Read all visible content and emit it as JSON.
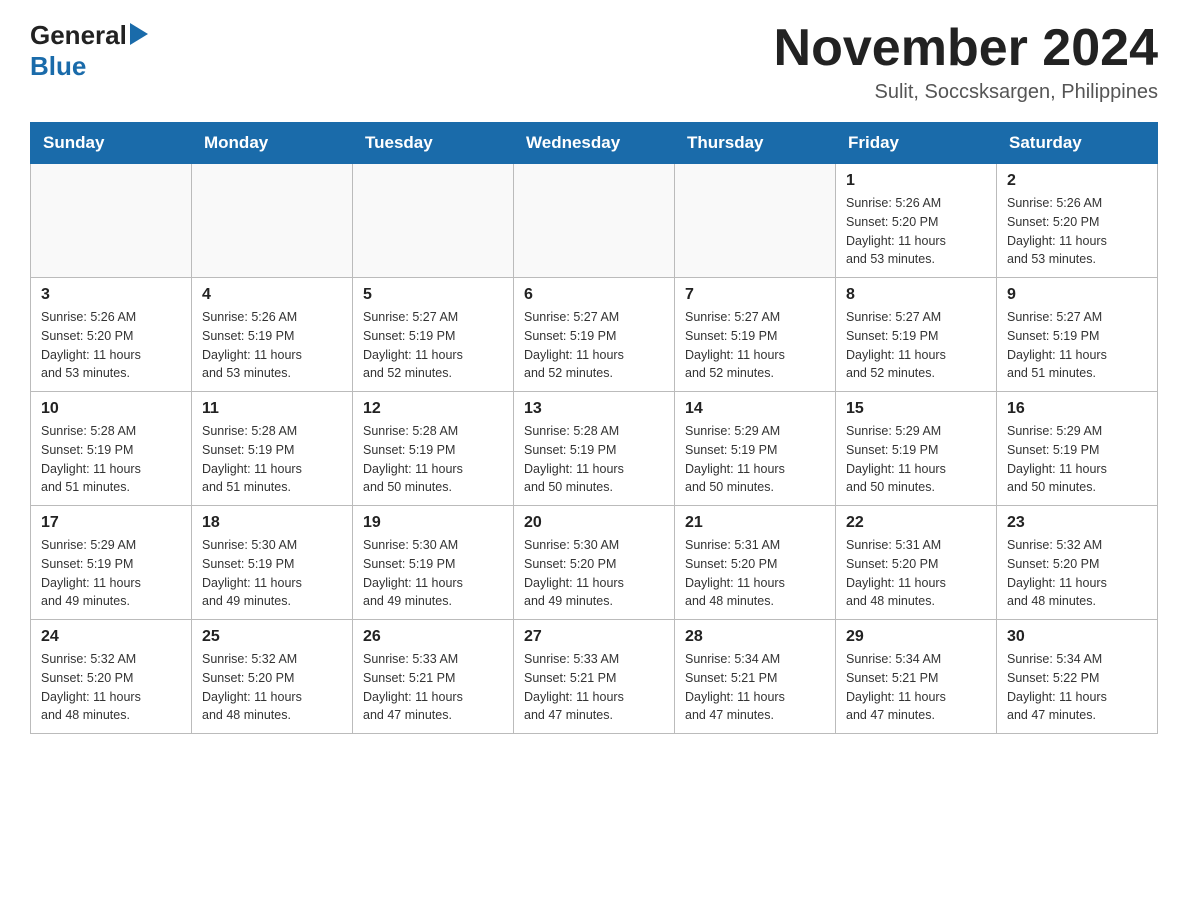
{
  "header": {
    "logo_general": "General",
    "logo_arrow": "▶",
    "logo_blue": "Blue",
    "month_year": "November 2024",
    "location": "Sulit, Soccsksargen, Philippines"
  },
  "days_of_week": [
    "Sunday",
    "Monday",
    "Tuesday",
    "Wednesday",
    "Thursday",
    "Friday",
    "Saturday"
  ],
  "weeks": [
    {
      "cells": [
        {
          "day": "",
          "info": ""
        },
        {
          "day": "",
          "info": ""
        },
        {
          "day": "",
          "info": ""
        },
        {
          "day": "",
          "info": ""
        },
        {
          "day": "",
          "info": ""
        },
        {
          "day": "1",
          "info": "Sunrise: 5:26 AM\nSunset: 5:20 PM\nDaylight: 11 hours\nand 53 minutes."
        },
        {
          "day": "2",
          "info": "Sunrise: 5:26 AM\nSunset: 5:20 PM\nDaylight: 11 hours\nand 53 minutes."
        }
      ]
    },
    {
      "cells": [
        {
          "day": "3",
          "info": "Sunrise: 5:26 AM\nSunset: 5:20 PM\nDaylight: 11 hours\nand 53 minutes."
        },
        {
          "day": "4",
          "info": "Sunrise: 5:26 AM\nSunset: 5:19 PM\nDaylight: 11 hours\nand 53 minutes."
        },
        {
          "day": "5",
          "info": "Sunrise: 5:27 AM\nSunset: 5:19 PM\nDaylight: 11 hours\nand 52 minutes."
        },
        {
          "day": "6",
          "info": "Sunrise: 5:27 AM\nSunset: 5:19 PM\nDaylight: 11 hours\nand 52 minutes."
        },
        {
          "day": "7",
          "info": "Sunrise: 5:27 AM\nSunset: 5:19 PM\nDaylight: 11 hours\nand 52 minutes."
        },
        {
          "day": "8",
          "info": "Sunrise: 5:27 AM\nSunset: 5:19 PM\nDaylight: 11 hours\nand 52 minutes."
        },
        {
          "day": "9",
          "info": "Sunrise: 5:27 AM\nSunset: 5:19 PM\nDaylight: 11 hours\nand 51 minutes."
        }
      ]
    },
    {
      "cells": [
        {
          "day": "10",
          "info": "Sunrise: 5:28 AM\nSunset: 5:19 PM\nDaylight: 11 hours\nand 51 minutes."
        },
        {
          "day": "11",
          "info": "Sunrise: 5:28 AM\nSunset: 5:19 PM\nDaylight: 11 hours\nand 51 minutes."
        },
        {
          "day": "12",
          "info": "Sunrise: 5:28 AM\nSunset: 5:19 PM\nDaylight: 11 hours\nand 50 minutes."
        },
        {
          "day": "13",
          "info": "Sunrise: 5:28 AM\nSunset: 5:19 PM\nDaylight: 11 hours\nand 50 minutes."
        },
        {
          "day": "14",
          "info": "Sunrise: 5:29 AM\nSunset: 5:19 PM\nDaylight: 11 hours\nand 50 minutes."
        },
        {
          "day": "15",
          "info": "Sunrise: 5:29 AM\nSunset: 5:19 PM\nDaylight: 11 hours\nand 50 minutes."
        },
        {
          "day": "16",
          "info": "Sunrise: 5:29 AM\nSunset: 5:19 PM\nDaylight: 11 hours\nand 50 minutes."
        }
      ]
    },
    {
      "cells": [
        {
          "day": "17",
          "info": "Sunrise: 5:29 AM\nSunset: 5:19 PM\nDaylight: 11 hours\nand 49 minutes."
        },
        {
          "day": "18",
          "info": "Sunrise: 5:30 AM\nSunset: 5:19 PM\nDaylight: 11 hours\nand 49 minutes."
        },
        {
          "day": "19",
          "info": "Sunrise: 5:30 AM\nSunset: 5:19 PM\nDaylight: 11 hours\nand 49 minutes."
        },
        {
          "day": "20",
          "info": "Sunrise: 5:30 AM\nSunset: 5:20 PM\nDaylight: 11 hours\nand 49 minutes."
        },
        {
          "day": "21",
          "info": "Sunrise: 5:31 AM\nSunset: 5:20 PM\nDaylight: 11 hours\nand 48 minutes."
        },
        {
          "day": "22",
          "info": "Sunrise: 5:31 AM\nSunset: 5:20 PM\nDaylight: 11 hours\nand 48 minutes."
        },
        {
          "day": "23",
          "info": "Sunrise: 5:32 AM\nSunset: 5:20 PM\nDaylight: 11 hours\nand 48 minutes."
        }
      ]
    },
    {
      "cells": [
        {
          "day": "24",
          "info": "Sunrise: 5:32 AM\nSunset: 5:20 PM\nDaylight: 11 hours\nand 48 minutes."
        },
        {
          "day": "25",
          "info": "Sunrise: 5:32 AM\nSunset: 5:20 PM\nDaylight: 11 hours\nand 48 minutes."
        },
        {
          "day": "26",
          "info": "Sunrise: 5:33 AM\nSunset: 5:21 PM\nDaylight: 11 hours\nand 47 minutes."
        },
        {
          "day": "27",
          "info": "Sunrise: 5:33 AM\nSunset: 5:21 PM\nDaylight: 11 hours\nand 47 minutes."
        },
        {
          "day": "28",
          "info": "Sunrise: 5:34 AM\nSunset: 5:21 PM\nDaylight: 11 hours\nand 47 minutes."
        },
        {
          "day": "29",
          "info": "Sunrise: 5:34 AM\nSunset: 5:21 PM\nDaylight: 11 hours\nand 47 minutes."
        },
        {
          "day": "30",
          "info": "Sunrise: 5:34 AM\nSunset: 5:22 PM\nDaylight: 11 hours\nand 47 minutes."
        }
      ]
    }
  ]
}
